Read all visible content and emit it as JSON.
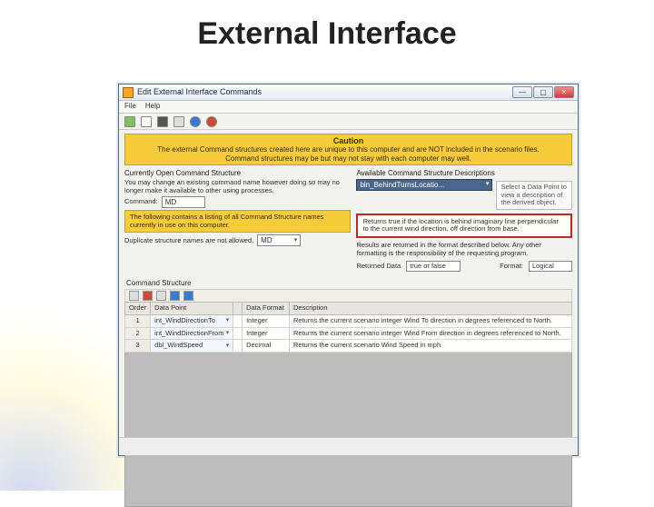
{
  "slide_title": "External Interface",
  "window": {
    "title": "Edit External Interface Commands",
    "menu": {
      "file": "File",
      "help": "Help"
    }
  },
  "caution": {
    "header": "Caution",
    "line1": "The external Command structures created here are unique to this computer and are NOT included in the scenario files.",
    "line2": "Command structures may be but may not stay with each computer may well."
  },
  "left": {
    "header": "Currently Open Command Structure",
    "note": "You may change an existing command name however doing so may no longer make it available to other using processes.",
    "command_label": "Command:",
    "command_value": "MD",
    "list_note_hl": "The following contains a listing of all Command Structure names currently in use on this computer.",
    "dup_note": "Duplicate structure names are not allowed.",
    "list_value": "MD"
  },
  "right": {
    "header": "Available Command Structure Descriptions",
    "combo_value": "bln_BehindTurnsLocatio...",
    "hint": "Select a Data Point to view a description of the derived object.",
    "emph": "Returns true if the location is behind imaginary line perpendicular to the current wind direction, off direction from base.",
    "result_note": "Results are returned in the format described below. Any other formatting is the responsibility of the requesting program.",
    "ret_label": "Returned Data",
    "ret_value": "true or false",
    "fmt_label": "Format:",
    "fmt_value": "Logical"
  },
  "grid": {
    "label": "Command Structure",
    "columns": {
      "order": "Order",
      "dp": "Data Point",
      "dn": "Data Format",
      "desc": "Description"
    },
    "rows": [
      {
        "n": "1",
        "dp": "int_WindDirectionTo",
        "fmt": "Integer",
        "desc": "Returns the current scenario integer Wind To direction in degrees referenced to North."
      },
      {
        "n": "2",
        "dp": "int_WindDirectionFrom",
        "fmt": "Integer",
        "desc": "Returns the current scenario integer Wind From direction in degrees referenced to North."
      },
      {
        "n": "3",
        "dp": "dbl_WindSpeed",
        "fmt": "Decimal",
        "desc": "Returns the current scenario Wind Speed in mph."
      }
    ]
  }
}
